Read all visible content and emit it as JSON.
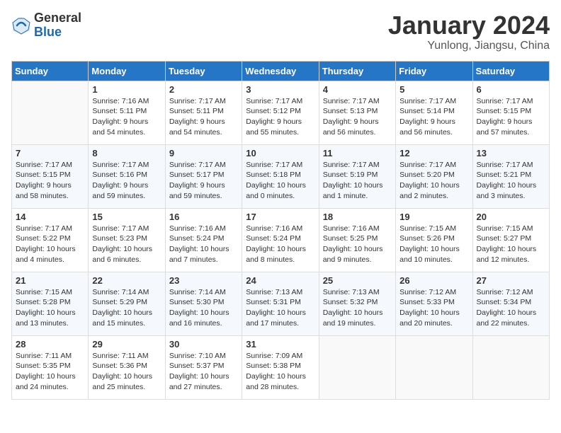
{
  "header": {
    "logo_general": "General",
    "logo_blue": "Blue",
    "title": "January 2024",
    "subtitle": "Yunlong, Jiangsu, China"
  },
  "weekdays": [
    "Sunday",
    "Monday",
    "Tuesday",
    "Wednesday",
    "Thursday",
    "Friday",
    "Saturday"
  ],
  "weeks": [
    [
      {
        "day": "",
        "info": ""
      },
      {
        "day": "1",
        "info": "Sunrise: 7:16 AM\nSunset: 5:11 PM\nDaylight: 9 hours\nand 54 minutes."
      },
      {
        "day": "2",
        "info": "Sunrise: 7:17 AM\nSunset: 5:11 PM\nDaylight: 9 hours\nand 54 minutes."
      },
      {
        "day": "3",
        "info": "Sunrise: 7:17 AM\nSunset: 5:12 PM\nDaylight: 9 hours\nand 55 minutes."
      },
      {
        "day": "4",
        "info": "Sunrise: 7:17 AM\nSunset: 5:13 PM\nDaylight: 9 hours\nand 56 minutes."
      },
      {
        "day": "5",
        "info": "Sunrise: 7:17 AM\nSunset: 5:14 PM\nDaylight: 9 hours\nand 56 minutes."
      },
      {
        "day": "6",
        "info": "Sunrise: 7:17 AM\nSunset: 5:15 PM\nDaylight: 9 hours\nand 57 minutes."
      }
    ],
    [
      {
        "day": "7",
        "info": "Sunrise: 7:17 AM\nSunset: 5:15 PM\nDaylight: 9 hours\nand 58 minutes."
      },
      {
        "day": "8",
        "info": "Sunrise: 7:17 AM\nSunset: 5:16 PM\nDaylight: 9 hours\nand 59 minutes."
      },
      {
        "day": "9",
        "info": "Sunrise: 7:17 AM\nSunset: 5:17 PM\nDaylight: 9 hours\nand 59 minutes."
      },
      {
        "day": "10",
        "info": "Sunrise: 7:17 AM\nSunset: 5:18 PM\nDaylight: 10 hours\nand 0 minutes."
      },
      {
        "day": "11",
        "info": "Sunrise: 7:17 AM\nSunset: 5:19 PM\nDaylight: 10 hours\nand 1 minute."
      },
      {
        "day": "12",
        "info": "Sunrise: 7:17 AM\nSunset: 5:20 PM\nDaylight: 10 hours\nand 2 minutes."
      },
      {
        "day": "13",
        "info": "Sunrise: 7:17 AM\nSunset: 5:21 PM\nDaylight: 10 hours\nand 3 minutes."
      }
    ],
    [
      {
        "day": "14",
        "info": "Sunrise: 7:17 AM\nSunset: 5:22 PM\nDaylight: 10 hours\nand 4 minutes."
      },
      {
        "day": "15",
        "info": "Sunrise: 7:17 AM\nSunset: 5:23 PM\nDaylight: 10 hours\nand 6 minutes."
      },
      {
        "day": "16",
        "info": "Sunrise: 7:16 AM\nSunset: 5:24 PM\nDaylight: 10 hours\nand 7 minutes."
      },
      {
        "day": "17",
        "info": "Sunrise: 7:16 AM\nSunset: 5:24 PM\nDaylight: 10 hours\nand 8 minutes."
      },
      {
        "day": "18",
        "info": "Sunrise: 7:16 AM\nSunset: 5:25 PM\nDaylight: 10 hours\nand 9 minutes."
      },
      {
        "day": "19",
        "info": "Sunrise: 7:15 AM\nSunset: 5:26 PM\nDaylight: 10 hours\nand 10 minutes."
      },
      {
        "day": "20",
        "info": "Sunrise: 7:15 AM\nSunset: 5:27 PM\nDaylight: 10 hours\nand 12 minutes."
      }
    ],
    [
      {
        "day": "21",
        "info": "Sunrise: 7:15 AM\nSunset: 5:28 PM\nDaylight: 10 hours\nand 13 minutes."
      },
      {
        "day": "22",
        "info": "Sunrise: 7:14 AM\nSunset: 5:29 PM\nDaylight: 10 hours\nand 15 minutes."
      },
      {
        "day": "23",
        "info": "Sunrise: 7:14 AM\nSunset: 5:30 PM\nDaylight: 10 hours\nand 16 minutes."
      },
      {
        "day": "24",
        "info": "Sunrise: 7:13 AM\nSunset: 5:31 PM\nDaylight: 10 hours\nand 17 minutes."
      },
      {
        "day": "25",
        "info": "Sunrise: 7:13 AM\nSunset: 5:32 PM\nDaylight: 10 hours\nand 19 minutes."
      },
      {
        "day": "26",
        "info": "Sunrise: 7:12 AM\nSunset: 5:33 PM\nDaylight: 10 hours\nand 20 minutes."
      },
      {
        "day": "27",
        "info": "Sunrise: 7:12 AM\nSunset: 5:34 PM\nDaylight: 10 hours\nand 22 minutes."
      }
    ],
    [
      {
        "day": "28",
        "info": "Sunrise: 7:11 AM\nSunset: 5:35 PM\nDaylight: 10 hours\nand 24 minutes."
      },
      {
        "day": "29",
        "info": "Sunrise: 7:11 AM\nSunset: 5:36 PM\nDaylight: 10 hours\nand 25 minutes."
      },
      {
        "day": "30",
        "info": "Sunrise: 7:10 AM\nSunset: 5:37 PM\nDaylight: 10 hours\nand 27 minutes."
      },
      {
        "day": "31",
        "info": "Sunrise: 7:09 AM\nSunset: 5:38 PM\nDaylight: 10 hours\nand 28 minutes."
      },
      {
        "day": "",
        "info": ""
      },
      {
        "day": "",
        "info": ""
      },
      {
        "day": "",
        "info": ""
      }
    ]
  ]
}
